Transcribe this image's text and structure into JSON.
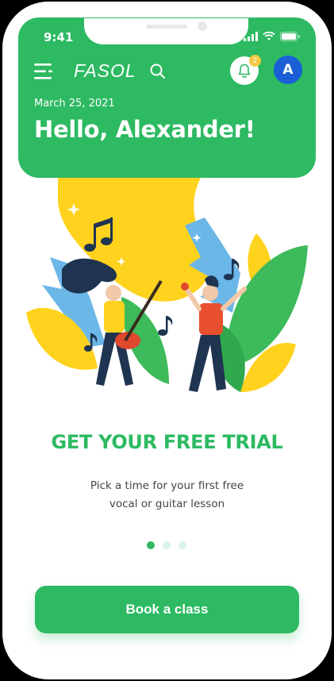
{
  "status_bar": {
    "time": "9:41"
  },
  "header": {
    "logo": "FASOL",
    "notification_count": "2",
    "avatar_initial": "A",
    "date": "March 25, 2021",
    "greeting": "Hello, Alexander!"
  },
  "promo": {
    "title": "GET YOUR FREE TRIAL",
    "subtitle_line1": "Pick a time for your first free",
    "subtitle_line2": "vocal or guitar lesson",
    "page_count": 3,
    "active_page": 1
  },
  "cta": {
    "label": "Book a class"
  },
  "colors": {
    "brand_green": "#2DBA62",
    "avatar_blue": "#1A5FD6",
    "badge_yellow": "#F5C842",
    "illustration_yellow": "#FFD21E",
    "leaf_blue": "#6BB7E8"
  },
  "icons": [
    "menu-icon",
    "search-icon",
    "bell-icon",
    "signal-icon",
    "wifi-icon",
    "battery-icon",
    "music-note-icon"
  ]
}
